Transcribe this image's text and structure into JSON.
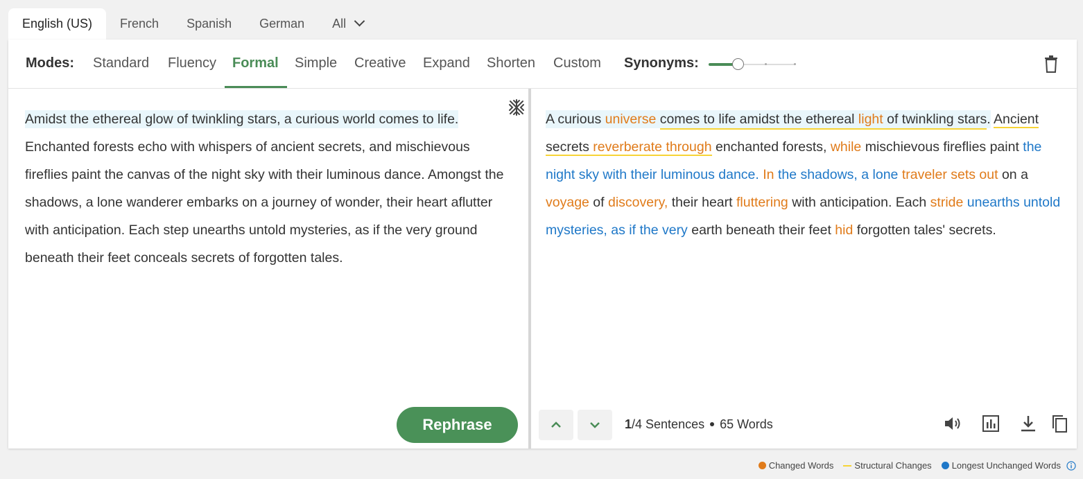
{
  "languages": {
    "tabs": [
      "English (US)",
      "French",
      "Spanish",
      "German",
      "All"
    ],
    "active_index": 0
  },
  "modes": {
    "label": "Modes:",
    "items": [
      "Standard",
      "Fluency",
      "Formal",
      "Simple",
      "Creative",
      "Expand",
      "Shorten",
      "Custom"
    ],
    "active": "Formal"
  },
  "synonyms": {
    "label": "Synonyms:",
    "level_fraction": 0.33
  },
  "input": {
    "sentences": [
      "Amidst the ethereal glow of twinkling stars, a curious world comes to life.",
      "Enchanted forests echo with whispers of ancient secrets, and mischievous fireflies paint the canvas of the night sky with their luminous dance.",
      "Amongst the shadows, a lone wanderer embarks on a journey of wonder, their heart aflutter with anticipation.",
      "Each step unearths untold mysteries, as if the very ground beneath their feet conceals secrets of forgotten tales."
    ]
  },
  "output": {
    "segments": [
      {
        "t": "A curious ",
        "k": "plain"
      },
      {
        "t": "universe",
        "k": "changed"
      },
      {
        "t": " ",
        "k": "plain"
      },
      {
        "t": "comes to life amidst the ethereal ",
        "k": "struct"
      },
      {
        "t": "light",
        "k": "changed-struct"
      },
      {
        "t": " of twinkling stars",
        "k": "struct"
      },
      {
        "t": ".",
        "k": "plain"
      },
      {
        "t": " ",
        "k": "plain"
      },
      {
        "t": "Ancient secrets ",
        "k": "struct"
      },
      {
        "t": "reverberate through",
        "k": "changed-struct"
      },
      {
        "t": " enchanted forests, ",
        "k": "plain"
      },
      {
        "t": "while",
        "k": "changed"
      },
      {
        "t": " mischievous fireflies paint ",
        "k": "plain"
      },
      {
        "t": "the night sky with their luminous dance.",
        "k": "unchanged"
      },
      {
        "t": " ",
        "k": "plain"
      },
      {
        "t": "In",
        "k": "changed"
      },
      {
        "t": " ",
        "k": "plain"
      },
      {
        "t": "the shadows, a lone",
        "k": "unchanged"
      },
      {
        "t": " ",
        "k": "plain"
      },
      {
        "t": "traveler sets out",
        "k": "changed"
      },
      {
        "t": " on a ",
        "k": "plain"
      },
      {
        "t": "voyage",
        "k": "changed"
      },
      {
        "t": " of ",
        "k": "plain"
      },
      {
        "t": "discovery,",
        "k": "changed"
      },
      {
        "t": " their heart ",
        "k": "plain"
      },
      {
        "t": "fluttering",
        "k": "changed"
      },
      {
        "t": " with anticipation. Each ",
        "k": "plain"
      },
      {
        "t": "stride",
        "k": "changed"
      },
      {
        "t": " ",
        "k": "plain"
      },
      {
        "t": "unearths untold mysteries, as if the very",
        "k": "unchanged"
      },
      {
        "t": " earth beneath their feet ",
        "k": "plain"
      },
      {
        "t": "hid",
        "k": "changed"
      },
      {
        "t": " forgotten tales' secrets.",
        "k": "plain"
      }
    ],
    "current": "1",
    "sentences_label": "/4 Sentences",
    "words_label": "65 Words"
  },
  "buttons": {
    "rephrase": "Rephrase"
  },
  "legend": {
    "changed": "Changed Words",
    "structural": "Structural Changes",
    "unchanged": "Longest Unchanged Words"
  },
  "colors": {
    "accent": "#4a8c57",
    "changed": "#e07b1a",
    "structural": "#f7d436",
    "unchanged": "#1f78c8",
    "highlight": "#e9f6fb"
  }
}
